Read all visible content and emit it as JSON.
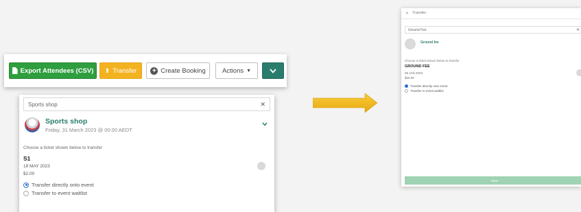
{
  "toolbar": {
    "export_label": "Export Attendees (CSV)",
    "transfer_label": "Transfer",
    "create_booking_label": "Create Booking",
    "actions_label": "Actions"
  },
  "left_panel": {
    "search_value": "Sports shop",
    "event": {
      "title": "Sports shop",
      "date": "Friday, 31 March 2023 @ 00:00 AEDT"
    },
    "hint": "Choose a ticket shown below to transfer",
    "ticket": {
      "name": "S1",
      "date": "19 MAY 2023",
      "price": "$2.00"
    },
    "options": [
      "Transfer directly onto event",
      "Transfer to event waitlist"
    ]
  },
  "right_panel": {
    "title": "Transfer",
    "search_value": "Ground Fee",
    "event_title": "Ground fee",
    "hint": "Choose a ticket shown below to transfer",
    "ticket": {
      "name": "GROUND FEE",
      "date": "06 JAN 2023",
      "price": "$20.00"
    },
    "options": [
      "Transfer directly onto event",
      "Transfer to event waitlist"
    ],
    "save_label": "Save"
  },
  "colors": {
    "export_green": "#2e9e3e",
    "transfer_orange": "#f3b321",
    "teal": "#2a7c6c",
    "arrow_yellow": "#f2b820",
    "save_green_light": "#9fd3b3"
  },
  "icons": {
    "export": "document-icon",
    "transfer": "upload-icon",
    "create_booking": "plus-circle-icon",
    "actions": "caret-down-icon",
    "dropdown": "chevron-down-icon",
    "clear": "close-icon",
    "flow_arrow": "arrow-right-icon"
  }
}
